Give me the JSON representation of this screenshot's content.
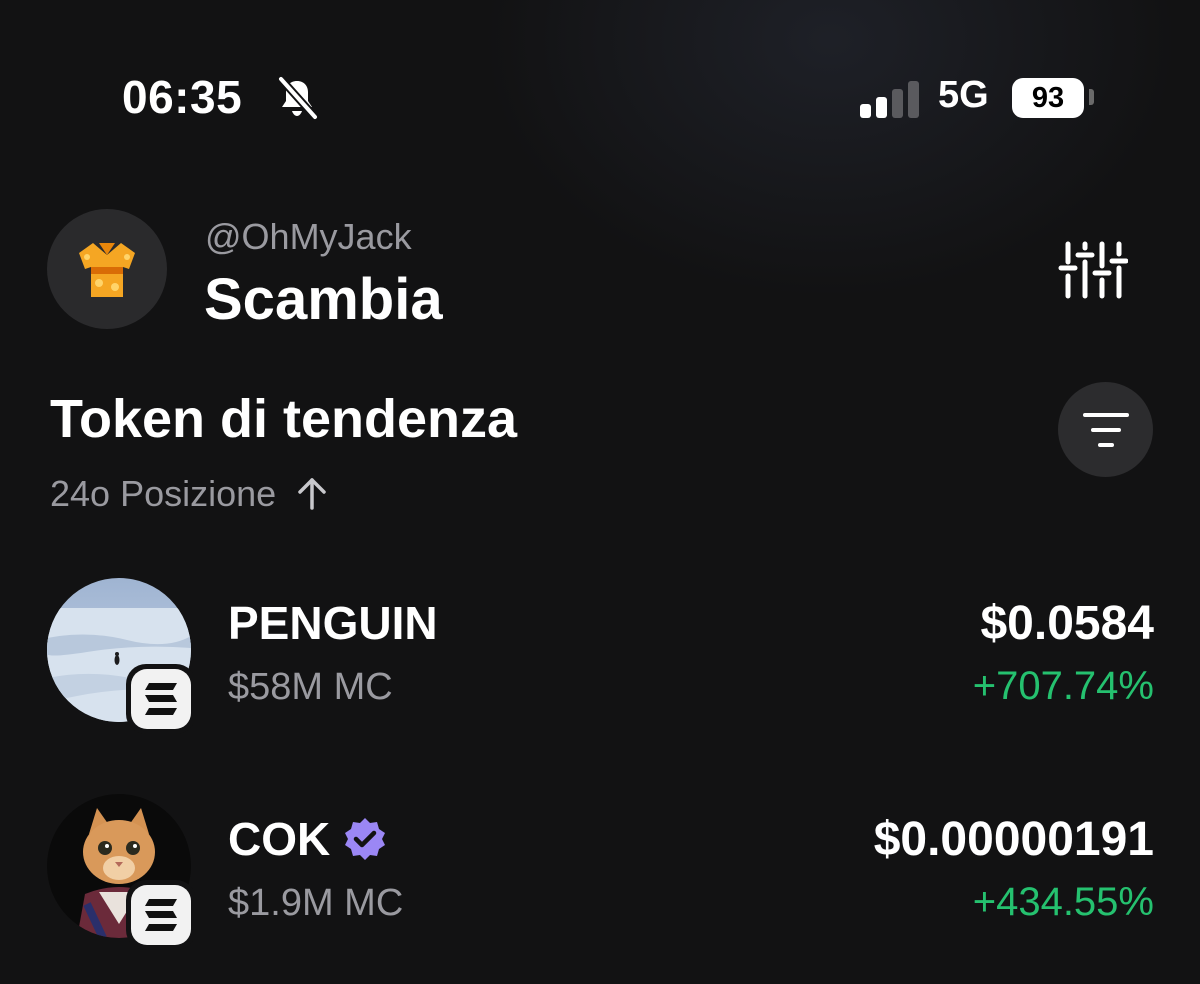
{
  "status_bar": {
    "time": "06:35",
    "silent_icon": "bell-slash-icon",
    "signal_icon": "cellular-signal-icon",
    "network": "5G",
    "battery": "93"
  },
  "header": {
    "avatar_icon": "kimono-icon",
    "handle": "@OhMyJack",
    "title": "Scambia",
    "settings_icon": "sliders-icon"
  },
  "trending": {
    "title": "Token di tendenza",
    "sort_label": "24o Posizione",
    "sort_icon": "arrow-up-icon",
    "filter_icon": "filter-lines-icon"
  },
  "tokens": [
    {
      "name": "PENGUIN",
      "market_cap": "$58M MC",
      "price": "$0.0584",
      "change": "+707.74%",
      "verified": false,
      "chain_icon": "solana-icon",
      "image": "penguin-on-ice-image"
    },
    {
      "name": "COK",
      "market_cap": "$1.9M MC",
      "price": "$0.00000191",
      "change": "+434.55%",
      "verified": true,
      "chain_icon": "solana-icon",
      "image": "cat-in-kimono-image"
    }
  ],
  "colors": {
    "background": "#121213",
    "positive": "#25c16f",
    "secondary_text": "#9a9aa0",
    "verified": "#9b87f5"
  }
}
